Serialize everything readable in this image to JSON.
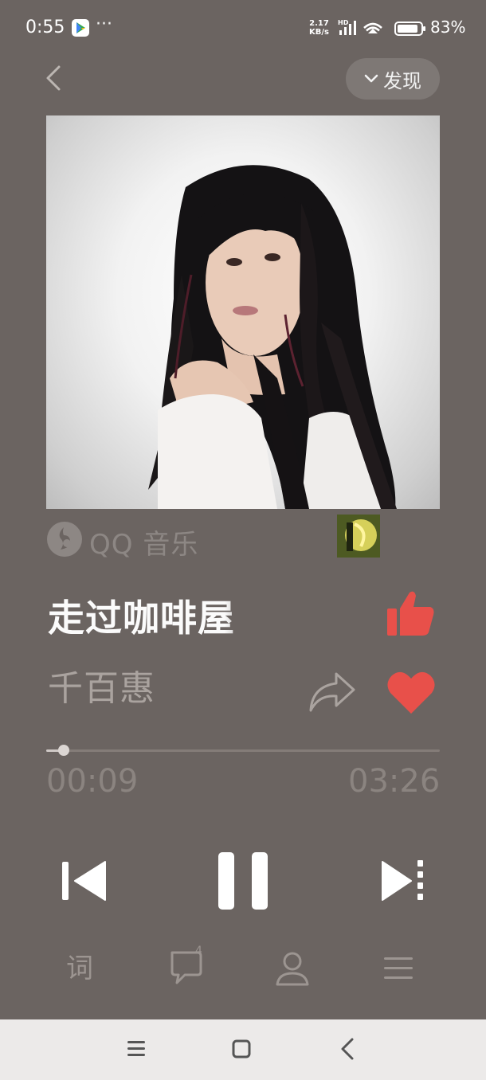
{
  "status": {
    "time": "0:55",
    "more": "···",
    "speed_value": "2.17",
    "speed_unit": "KB/s",
    "hd": "HD",
    "battery": "83%"
  },
  "header": {
    "discover_label": "发现",
    "back_icon": "chevron-left-icon",
    "discover_icon": "chevron-down-icon"
  },
  "branding": {
    "name": "QQ 音乐"
  },
  "song": {
    "title": "走过咖啡屋",
    "artist": "千百惠"
  },
  "progress": {
    "current": "00:09",
    "total": "03:26",
    "fraction": 0.044
  },
  "comments": {
    "count": "4"
  },
  "nav_bottom": {
    "lyrics_label": "词"
  },
  "colors": {
    "background": "#6b6461",
    "accent_red": "#e8504a",
    "muted_text": "#8b8480"
  }
}
